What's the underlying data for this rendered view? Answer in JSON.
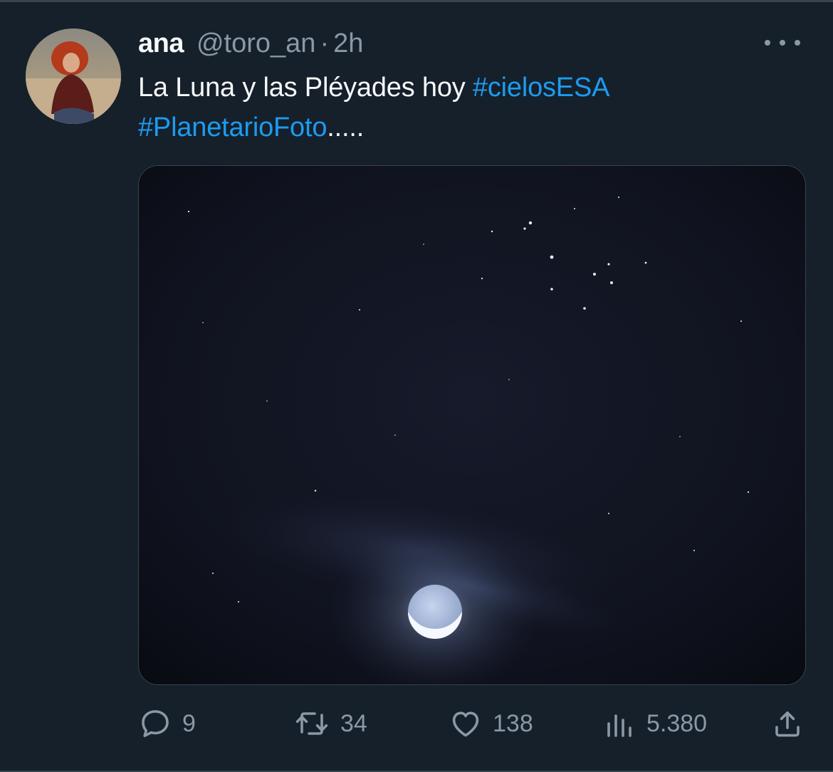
{
  "author": {
    "name": "ana",
    "handle": "@toro_an",
    "separator": "·",
    "time": "2h"
  },
  "tweet": {
    "text_plain": "La Luna y las Pléyades hoy",
    "hashtag1": "#cielosESA",
    "hashtag2": "#PlanetarioFoto",
    "suffix": "....."
  },
  "media": {
    "description_icon": "night-sky-photo"
  },
  "actions": {
    "reply": {
      "icon": "reply-icon",
      "count": "9"
    },
    "retweet": {
      "icon": "retweet-icon",
      "count": "34"
    },
    "like": {
      "icon": "heart-icon",
      "count": "138"
    },
    "views": {
      "icon": "views-chart-icon",
      "count": "5.380"
    },
    "share": {
      "icon": "share-icon"
    }
  },
  "colors": {
    "background": "#15202b",
    "primary_text": "#f7f9f9",
    "secondary_text": "#8b98a5",
    "link": "#1d9bf0",
    "border": "#38444d"
  }
}
